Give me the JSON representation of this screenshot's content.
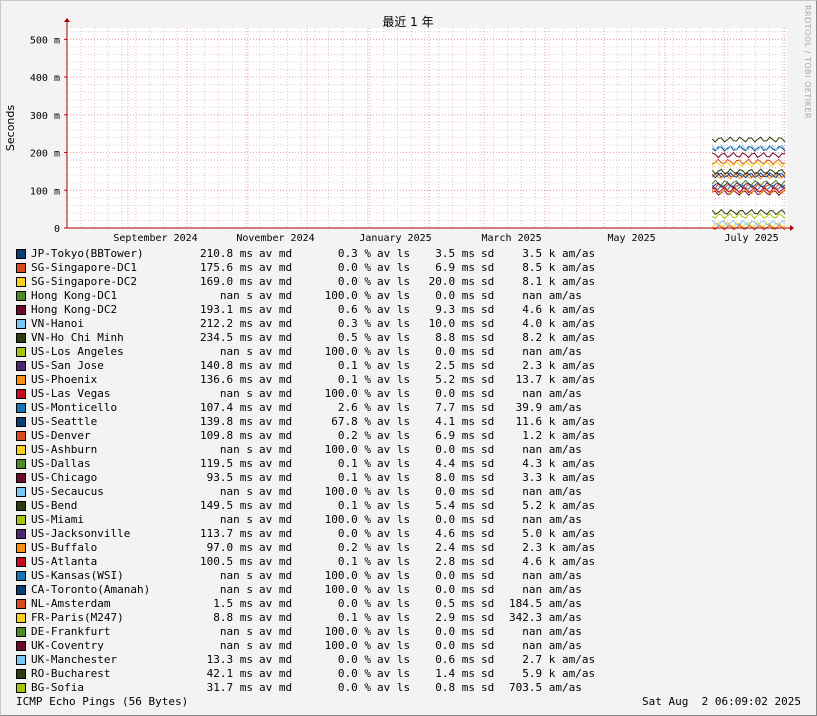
{
  "chart_data": {
    "type": "line",
    "title": "最近 1 年",
    "ylabel": "Seconds",
    "y_ticks": [
      "0",
      "100 m",
      "200 m",
      "300 m",
      "400 m",
      "500 m"
    ],
    "ylim": [
      0,
      0.53
    ],
    "x_ticks": [
      "September 2024",
      "November 2024",
      "January 2025",
      "March 2025",
      "May 2025",
      "July 2025"
    ],
    "x_range": [
      "2024-08-01",
      "2025-08-02"
    ],
    "grid": true,
    "series": [
      {
        "name": "JP-Tokyo(BBTower)",
        "color": "#0a3c78",
        "median": "210.8 ms",
        "loss": "0.3 %",
        "stdev": "3.5 ms",
        "rate": "3.5 k am/as",
        "start": "2025-06-25",
        "level": 0.2108
      },
      {
        "name": "SG-Singapore-DC1",
        "color": "#d8491c",
        "median": "175.6 ms",
        "loss": "0.0 %",
        "stdev": "6.9 ms",
        "rate": "8.5 k am/as",
        "start": "2025-06-25",
        "level": 0.1756
      },
      {
        "name": "SG-Singapore-DC2",
        "color": "#f8cf1d",
        "median": "169.0 ms",
        "loss": "0.0 %",
        "stdev": "20.0 ms",
        "rate": "8.1 k am/as",
        "start": "2025-06-25",
        "level": 0.169
      },
      {
        "name": "Hong Kong-DC1",
        "color": "#4a8a28",
        "median": "nan s",
        "loss": "100.0 %",
        "stdev": "0.0 ms",
        "rate": "nan am/as",
        "start": "2025-06-25",
        "level": null
      },
      {
        "name": "Hong Kong-DC2",
        "color": "#70082e",
        "median": "193.1 ms",
        "loss": "0.6 %",
        "stdev": "9.3 ms",
        "rate": "4.6 k am/as",
        "start": "2025-06-25",
        "level": 0.1931
      },
      {
        "name": "VN-Hanoi",
        "color": "#7cc6f4",
        "median": "212.2 ms",
        "loss": "0.3 %",
        "stdev": "10.0 ms",
        "rate": "4.0 k am/as",
        "start": "2025-06-25",
        "level": 0.2122
      },
      {
        "name": "VN-Ho Chi Minh",
        "color": "#293c0c",
        "median": "234.5 ms",
        "loss": "0.5 %",
        "stdev": "8.8 ms",
        "rate": "8.2 k am/as",
        "start": "2025-06-25",
        "level": 0.2345
      },
      {
        "name": "US-Los Angeles",
        "color": "#a6c40e",
        "median": "nan s",
        "loss": "100.0 %",
        "stdev": "0.0 ms",
        "rate": "nan am/as",
        "start": "2025-06-25",
        "level": null
      },
      {
        "name": "US-San Jose",
        "color": "#4c2870",
        "median": "140.8 ms",
        "loss": "0.1 %",
        "stdev": "2.5 ms",
        "rate": "2.3 k am/as",
        "start": "2025-06-25",
        "level": 0.1408
      },
      {
        "name": "US-Phoenix",
        "color": "#f78f12",
        "median": "136.6 ms",
        "loss": "0.1 %",
        "stdev": "5.2 ms",
        "rate": "13.7 k am/as",
        "start": "2025-06-25",
        "level": 0.1366
      },
      {
        "name": "US-Las Vegas",
        "color": "#c00b1a",
        "median": "nan s",
        "loss": "100.0 %",
        "stdev": "0.0 ms",
        "rate": "nan am/as",
        "start": "2025-06-25",
        "level": null
      },
      {
        "name": "US-Monticello",
        "color": "#1478b4",
        "median": "107.4 ms",
        "loss": "2.6 %",
        "stdev": "7.7 ms",
        "rate": "39.9 am/as",
        "start": "2025-06-25",
        "level": 0.1074
      },
      {
        "name": "US-Seattle",
        "color": "#0a3c78",
        "median": "139.8 ms",
        "loss": "67.8 %",
        "stdev": "4.1 ms",
        "rate": "11.6 k am/as",
        "start": "2025-06-25",
        "level": 0.1398
      },
      {
        "name": "US-Denver",
        "color": "#d8491c",
        "median": "109.8 ms",
        "loss": "0.2 %",
        "stdev": "6.9 ms",
        "rate": "1.2 k am/as",
        "start": "2025-06-25",
        "level": 0.1098
      },
      {
        "name": "US-Ashburn",
        "color": "#f8cf1d",
        "median": "nan s",
        "loss": "100.0 %",
        "stdev": "0.0 ms",
        "rate": "nan am/as",
        "start": "2025-06-25",
        "level": null
      },
      {
        "name": "US-Dallas",
        "color": "#4a8a28",
        "median": "119.5 ms",
        "loss": "0.1 %",
        "stdev": "4.4 ms",
        "rate": "4.3 k am/as",
        "start": "2025-06-25",
        "level": 0.1195
      },
      {
        "name": "US-Chicago",
        "color": "#70082e",
        "median": "93.5 ms",
        "loss": "0.1 %",
        "stdev": "8.0 ms",
        "rate": "3.3 k am/as",
        "start": "2025-06-25",
        "level": 0.0935
      },
      {
        "name": "US-Secaucus",
        "color": "#7cc6f4",
        "median": "nan s",
        "loss": "100.0 %",
        "stdev": "0.0 ms",
        "rate": "nan am/as",
        "start": "2025-06-25",
        "level": null
      },
      {
        "name": "US-Bend",
        "color": "#293c0c",
        "median": "149.5 ms",
        "loss": "0.1 %",
        "stdev": "5.4 ms",
        "rate": "5.2 k am/as",
        "start": "2025-06-25",
        "level": 0.1495
      },
      {
        "name": "US-Miami",
        "color": "#a6c40e",
        "median": "nan s",
        "loss": "100.0 %",
        "stdev": "0.0 ms",
        "rate": "nan am/as",
        "start": "2025-06-25",
        "level": null
      },
      {
        "name": "US-Jacksonville",
        "color": "#4c2870",
        "median": "113.7 ms",
        "loss": "0.0 %",
        "stdev": "4.6 ms",
        "rate": "5.0 k am/as",
        "start": "2025-06-25",
        "level": 0.1137
      },
      {
        "name": "US-Buffalo",
        "color": "#f78f12",
        "median": "97.0 ms",
        "loss": "0.2 %",
        "stdev": "2.4 ms",
        "rate": "2.3 k am/as",
        "start": "2025-06-25",
        "level": 0.097
      },
      {
        "name": "US-Atlanta",
        "color": "#c00b1a",
        "median": "100.5 ms",
        "loss": "0.1 %",
        "stdev": "2.8 ms",
        "rate": "4.6 k am/as",
        "start": "2025-06-25",
        "level": 0.1005
      },
      {
        "name": "US-Kansas(WSI)",
        "color": "#1478b4",
        "median": "nan s",
        "loss": "100.0 %",
        "stdev": "0.0 ms",
        "rate": "nan am/as",
        "start": "2025-06-25",
        "level": null
      },
      {
        "name": "CA-Toronto(Amanah)",
        "color": "#0a3c78",
        "median": "nan s",
        "loss": "100.0 %",
        "stdev": "0.0 ms",
        "rate": "nan am/as",
        "start": "2025-06-25",
        "level": null
      },
      {
        "name": "NL-Amsterdam",
        "color": "#d8491c",
        "median": "1.5 ms",
        "loss": "0.0 %",
        "stdev": "0.5 ms",
        "rate": "184.5 am/as",
        "start": "2025-06-25",
        "level": 0.0015
      },
      {
        "name": "FR-Paris(M247)",
        "color": "#f8cf1d",
        "median": "8.8 ms",
        "loss": "0.1 %",
        "stdev": "2.9 ms",
        "rate": "342.3 am/as",
        "start": "2025-06-25",
        "level": 0.0088
      },
      {
        "name": "DE-Frankfurt",
        "color": "#4a8a28",
        "median": "nan s",
        "loss": "100.0 %",
        "stdev": "0.0 ms",
        "rate": "nan am/as",
        "start": "2025-06-25",
        "level": null
      },
      {
        "name": "UK-Coventry",
        "color": "#70082e",
        "median": "nan s",
        "loss": "100.0 %",
        "stdev": "0.0 ms",
        "rate": "nan am/as",
        "start": "2025-06-25",
        "level": null
      },
      {
        "name": "UK-Manchester",
        "color": "#7cc6f4",
        "median": "13.3 ms",
        "loss": "0.0 %",
        "stdev": "0.6 ms",
        "rate": "2.7 k am/as",
        "start": "2025-06-25",
        "level": 0.0133
      },
      {
        "name": "RO-Bucharest",
        "color": "#293c0c",
        "median": "42.1 ms",
        "loss": "0.0 %",
        "stdev": "1.4 ms",
        "rate": "5.9 k am/as",
        "start": "2025-06-25",
        "level": 0.0421
      },
      {
        "name": "BG-Sofia",
        "color": "#a6c40e",
        "median": "31.7 ms",
        "loss": "0.0 %",
        "stdev": "0.8 ms",
        "rate": "703.5 am/as",
        "start": "2025-06-25",
        "level": 0.0317
      }
    ]
  },
  "labels": {
    "av_md": "av md",
    "av_ls": "av ls",
    "sd": "sd"
  },
  "footer": {
    "left": "ICMP Echo Pings (56 Bytes)",
    "right": "Sat Aug  2 06:09:02 2025"
  },
  "vendor": "RRDTOOL / TOBI OETIKER"
}
